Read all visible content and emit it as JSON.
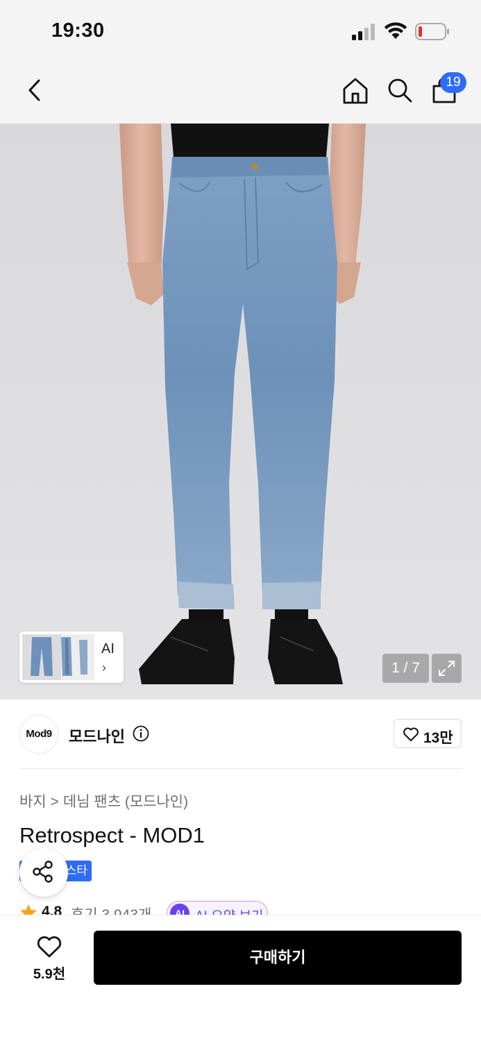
{
  "status_bar": {
    "time": "19:30",
    "signal_icon": "cellular-signal-icon",
    "wifi_icon": "wifi-icon",
    "battery_icon": "battery-low-icon",
    "battery_level": 0.15
  },
  "nav": {
    "back_icon": "chevron-left-icon",
    "home_icon": "home-icon",
    "search_icon": "search-icon",
    "cart_icon": "shopping-bag-icon",
    "cart_count": "19",
    "badge_color": "#2f6cf6"
  },
  "gallery": {
    "thumbnail_label": "AI",
    "thumbnail_chevron": "›",
    "counter": "1 / 7",
    "expand_icon": "expand-icon"
  },
  "brand": {
    "logo_text": "Mod9",
    "name": "모드나인",
    "info_icon": "info-icon",
    "like_icon": "heart-outline-icon",
    "like_count": "13만"
  },
  "breadcrumb": {
    "category": "바지",
    "separator": ">",
    "subcategory": "데님 팬츠 (모드나인)"
  },
  "product": {
    "title": "Retrospect - MOD1",
    "tag": "스타",
    "tag_color": "#2f6cf6",
    "share_icon": "share-icon"
  },
  "rating": {
    "star_icon": "star-icon",
    "value": "4.8",
    "reviews": "후기 3,943개",
    "ai_icon_text": "AI",
    "ai_summary_label": "AI 요약 보기",
    "ai_color": "#6b3ff0"
  },
  "bottom": {
    "wish_icon": "heart-outline-icon",
    "wish_count": "5.9천",
    "buy_label": "구매하기"
  }
}
